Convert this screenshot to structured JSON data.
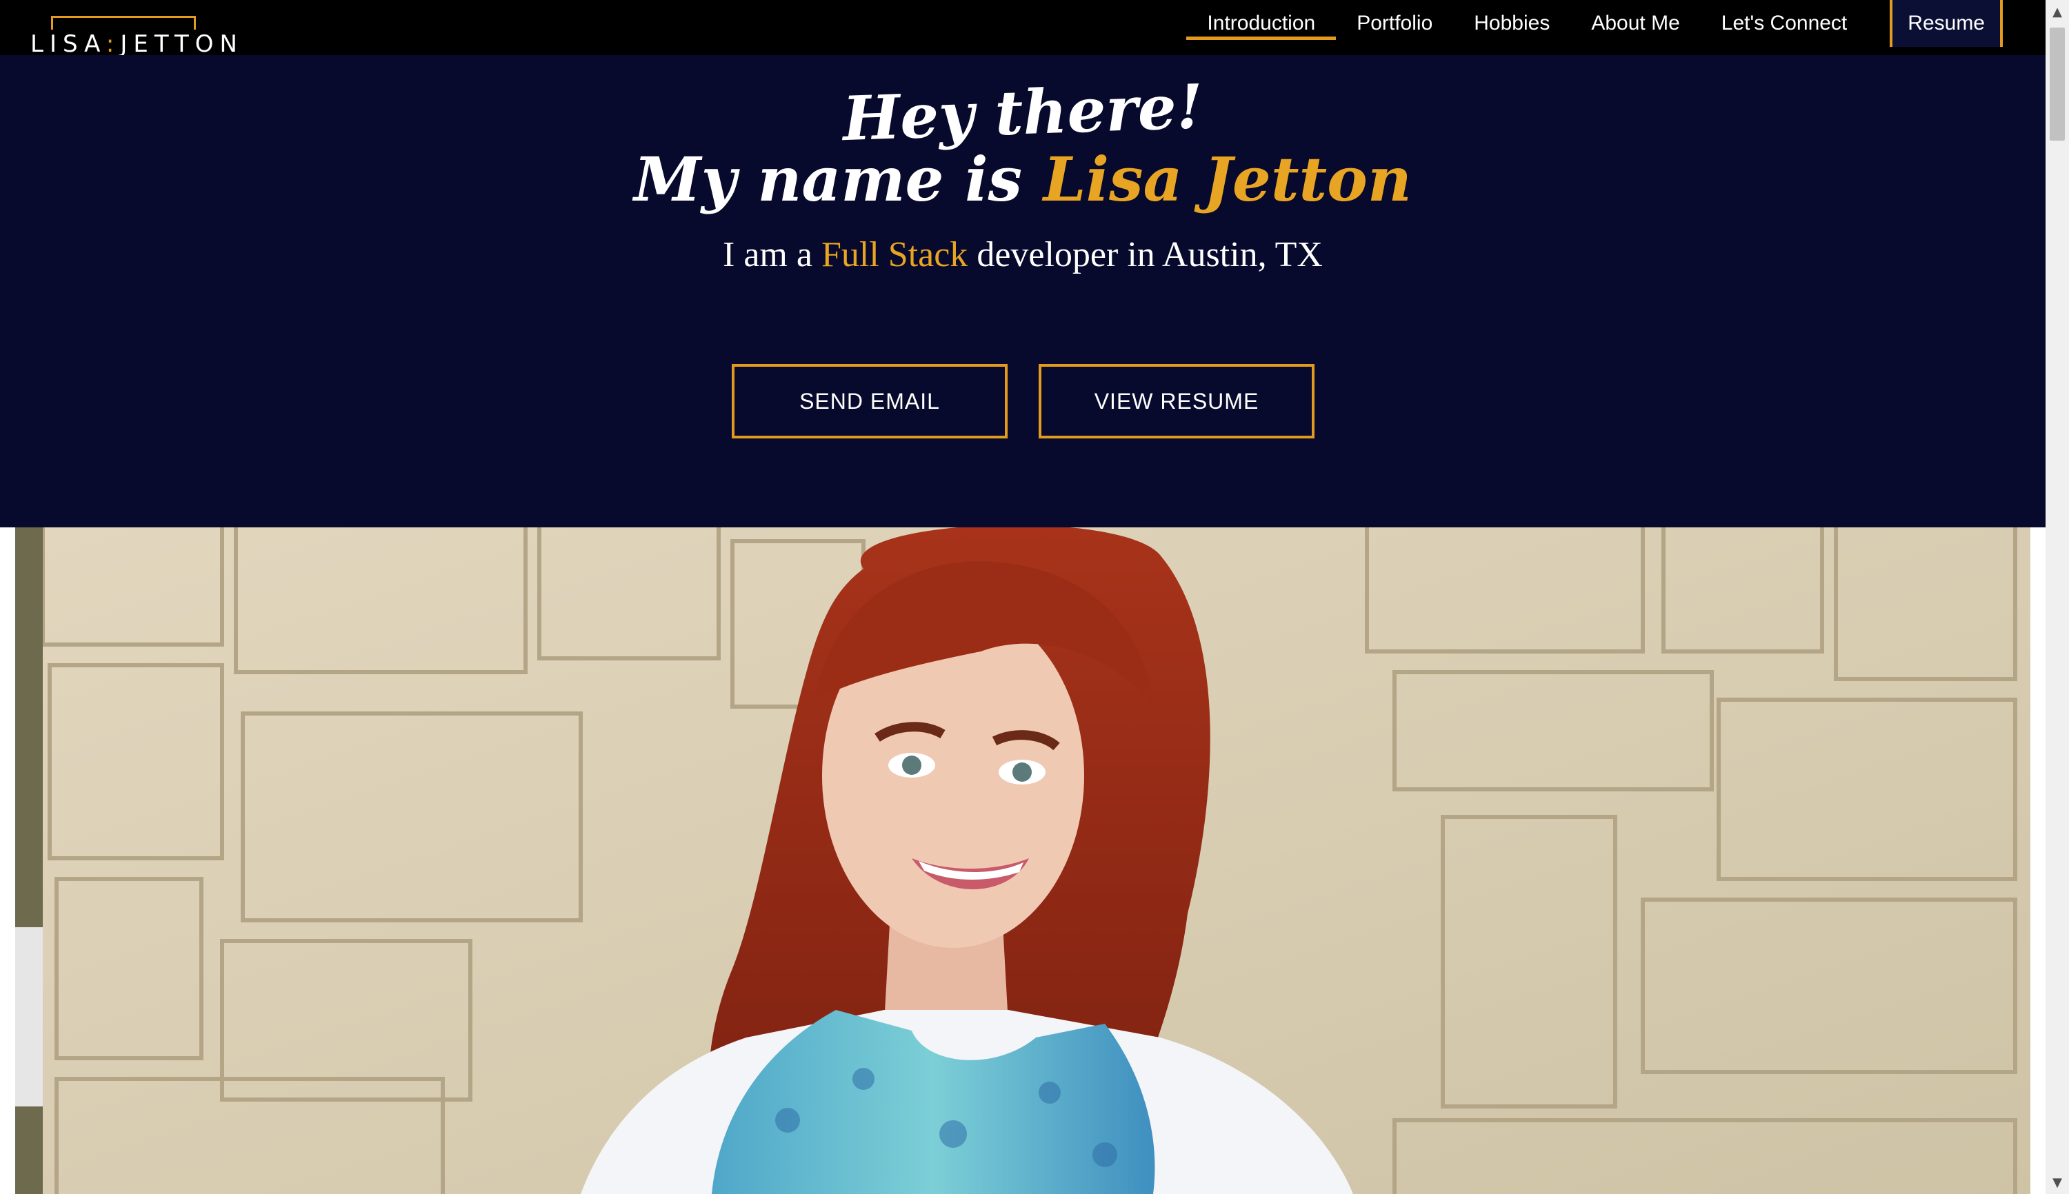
{
  "logo": {
    "left": "LISA",
    "dot": ":",
    "right": "JETTON"
  },
  "nav": {
    "items": [
      {
        "label": "Introduction",
        "active": true
      },
      {
        "label": "Portfolio"
      },
      {
        "label": "Hobbies"
      },
      {
        "label": "About Me"
      },
      {
        "label": "Let's Connect"
      }
    ],
    "resume_label": "Resume"
  },
  "hero": {
    "greeting_line1": "Hey there!",
    "greeting_line2_prefix": "My name is ",
    "name": "Lisa Jetton",
    "tagline_prefix": "I am a ",
    "tagline_accent": "Full Stack",
    "tagline_suffix": " developer in Austin, TX",
    "send_email_label": "SEND EMAIL",
    "view_resume_label": "VIEW RESUME"
  },
  "colors": {
    "accent": "#e39b1d",
    "hero_bg": "#070a2c",
    "nav_bg": "#000000"
  },
  "scrollbar": {
    "up_icon": "▲",
    "down_icon": "▼"
  }
}
